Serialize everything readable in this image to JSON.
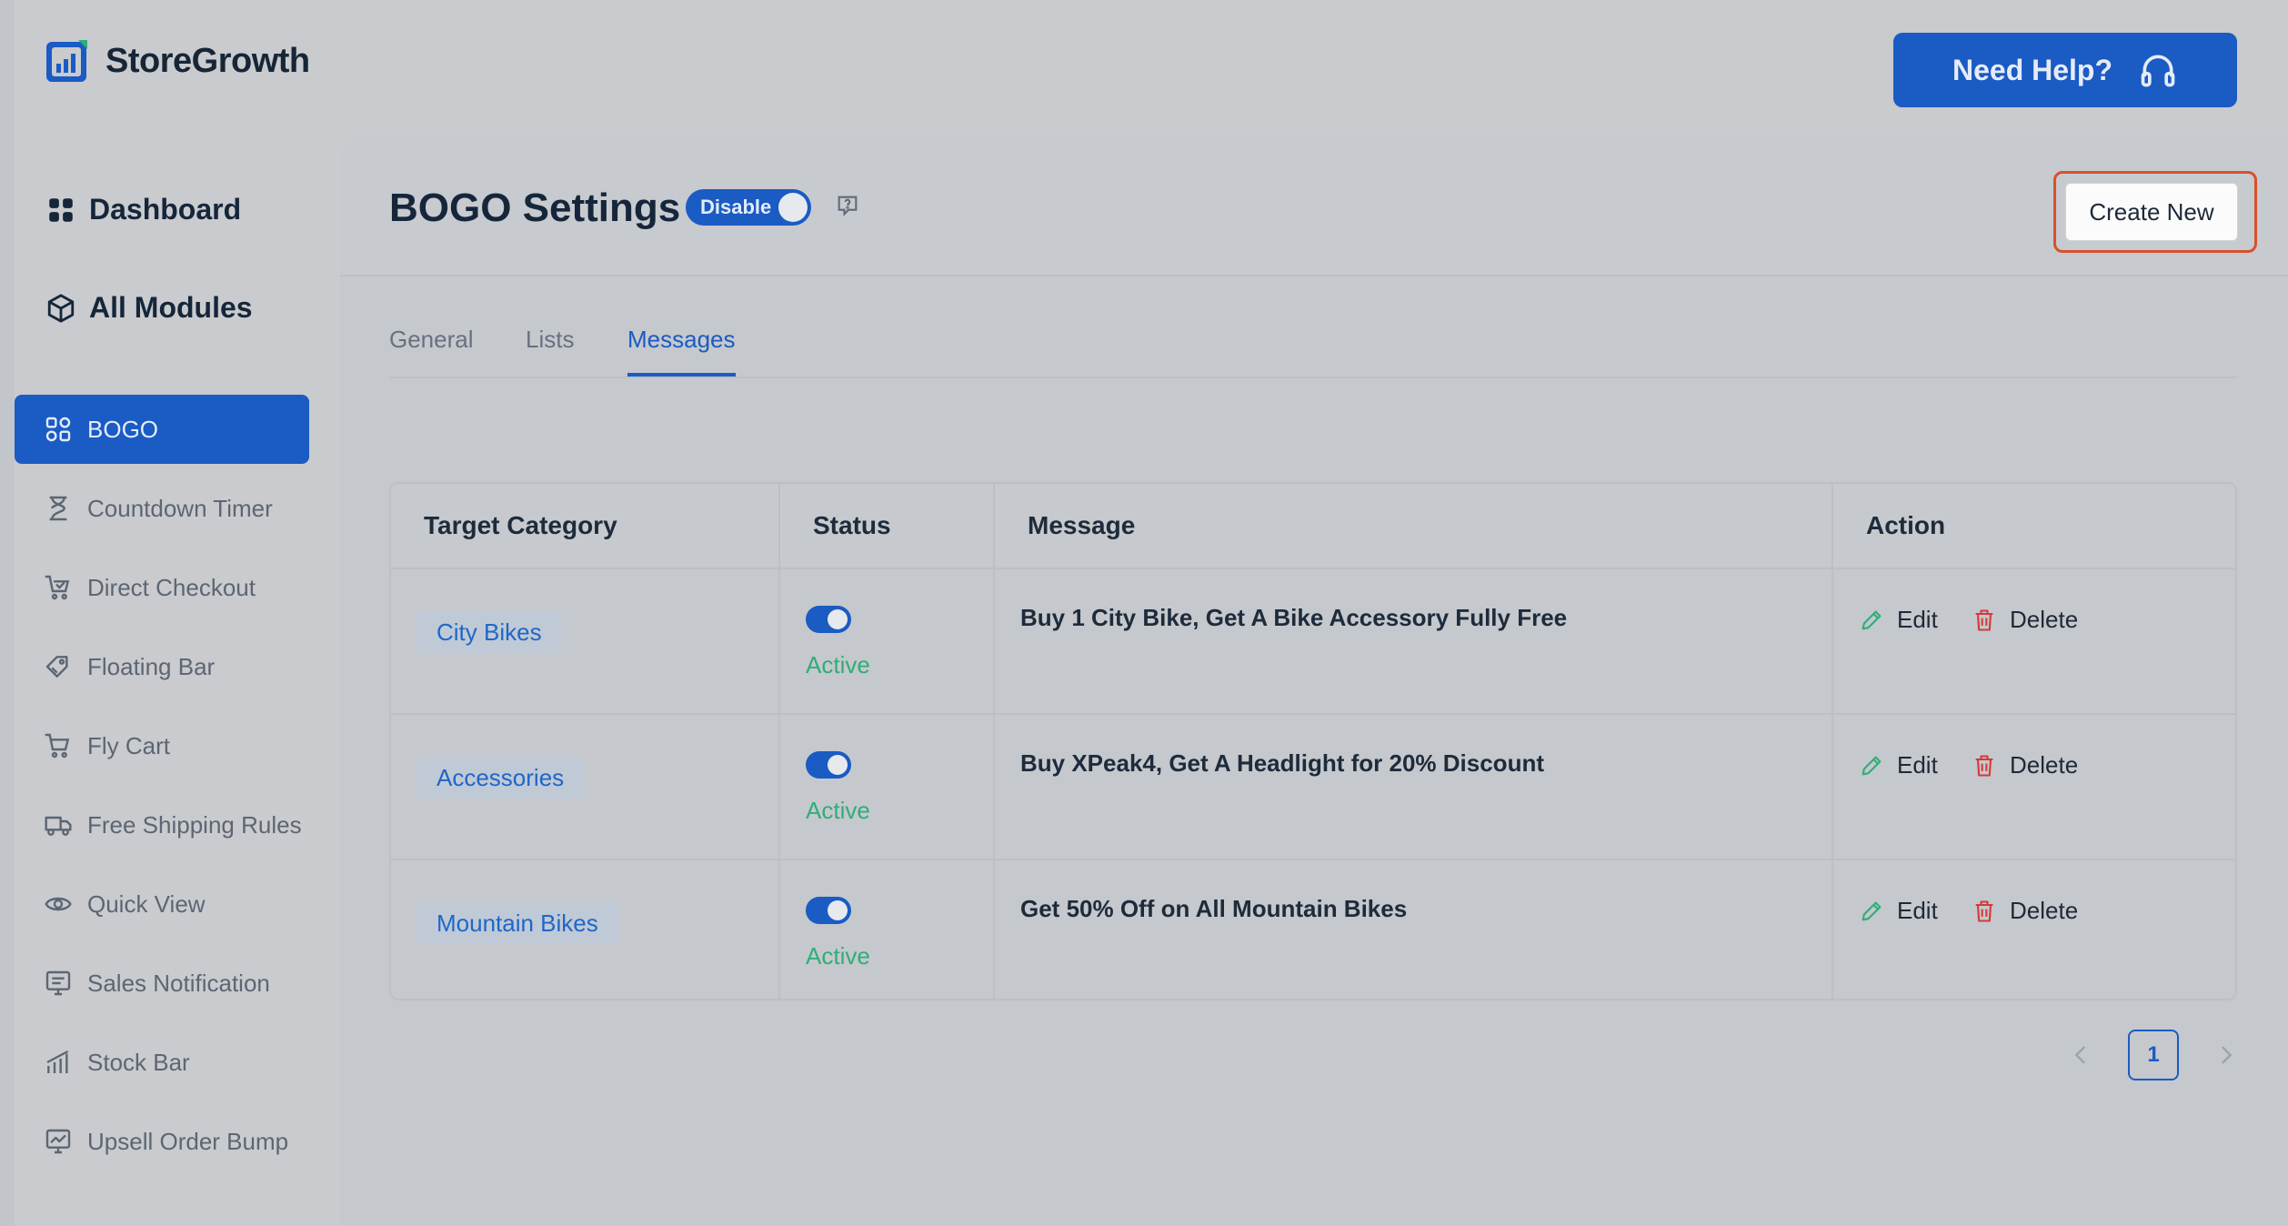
{
  "brand": {
    "name": "StoreGrowth"
  },
  "header": {
    "help_label": "Need Help?"
  },
  "sidebar": {
    "dashboard": "Dashboard",
    "all_modules": "All Modules",
    "items": [
      {
        "label": "BOGO",
        "icon": "bogo-icon",
        "active": true
      },
      {
        "label": "Countdown Timer",
        "icon": "hourglass-icon"
      },
      {
        "label": "Direct Checkout",
        "icon": "cart-check-icon"
      },
      {
        "label": "Floating Bar",
        "icon": "tags-icon"
      },
      {
        "label": "Fly Cart",
        "icon": "cart-icon"
      },
      {
        "label": "Free Shipping Rules",
        "icon": "truck-icon"
      },
      {
        "label": "Quick View",
        "icon": "eye-icon"
      },
      {
        "label": "Sales Notification",
        "icon": "notification-icon"
      },
      {
        "label": "Stock Bar",
        "icon": "bar-chart-icon"
      },
      {
        "label": "Upsell Order Bump",
        "icon": "trend-up-icon"
      }
    ]
  },
  "page": {
    "title": "BOGO Settings",
    "toggle_label": "Disable",
    "create_label": "Create New"
  },
  "tabs": [
    {
      "label": "General",
      "active": false
    },
    {
      "label": "Lists",
      "active": false
    },
    {
      "label": "Messages",
      "active": true
    }
  ],
  "table": {
    "headers": [
      "Target Category",
      "Status",
      "Message",
      "Action"
    ],
    "rows": [
      {
        "category": "City Bikes",
        "status": "Active",
        "message": "Buy 1 City Bike, Get A Bike Accessory Fully Free",
        "edit": "Edit",
        "delete": "Delete"
      },
      {
        "category": "Accessories",
        "status": "Active",
        "message": "Buy XPeak4, Get A Headlight for 20% Discount",
        "edit": "Edit",
        "delete": "Delete"
      },
      {
        "category": "Mountain Bikes",
        "status": "Active",
        "message": "Get 50% Off on All Mountain Bikes",
        "edit": "Edit",
        "delete": "Delete"
      }
    ]
  },
  "pagination": {
    "current": "1"
  },
  "colors": {
    "accent": "#1a5bc4",
    "active_status": "#2fae78",
    "delete": "#d43a3a",
    "edit": "#2fae78",
    "highlight_border": "#d9502b"
  }
}
